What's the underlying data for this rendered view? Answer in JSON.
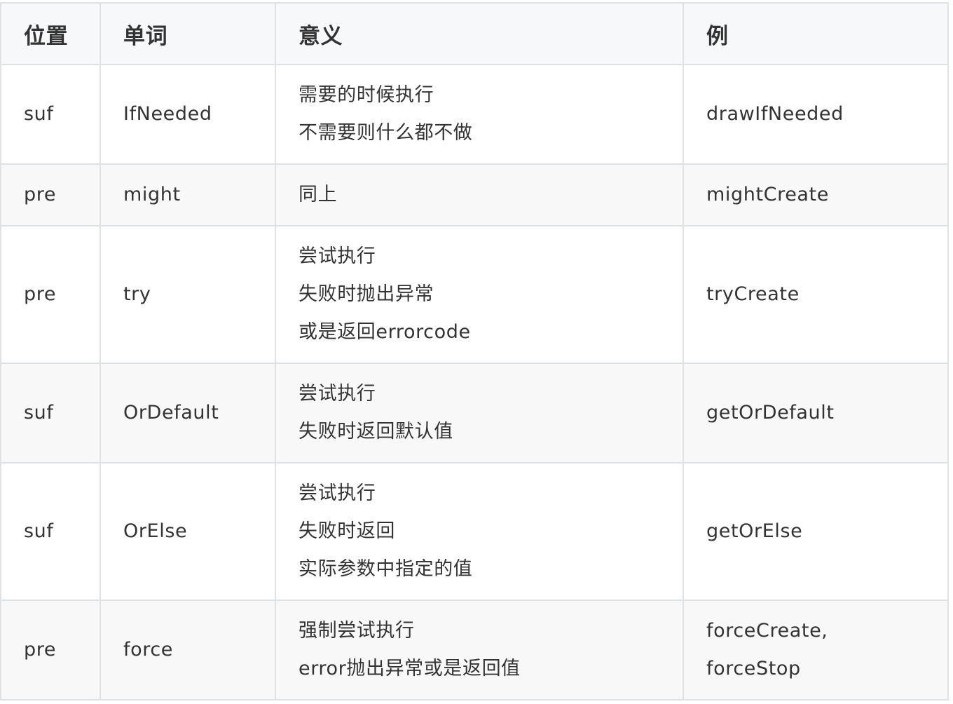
{
  "table": {
    "headers": [
      "位置",
      "单词",
      "意义",
      "例"
    ],
    "rows": [
      {
        "position": "suf",
        "word": "IfNeeded",
        "meaning": [
          "需要的时候执行",
          "不需要则什么都不做"
        ],
        "example": [
          "drawIfNeeded"
        ]
      },
      {
        "position": "pre",
        "word": "might",
        "meaning": [
          "同上"
        ],
        "example": [
          "mightCreate"
        ]
      },
      {
        "position": "pre",
        "word": "try",
        "meaning": [
          "尝试执行",
          "失败时抛出异常",
          "或是返回errorcode"
        ],
        "example": [
          "tryCreate"
        ]
      },
      {
        "position": "suf",
        "word": "OrDefault",
        "meaning": [
          "尝试执行",
          "失败时返回默认值"
        ],
        "example": [
          "getOrDefault"
        ]
      },
      {
        "position": "suf",
        "word": "OrElse",
        "meaning": [
          "尝试执行",
          "失败时返回",
          "实际参数中指定的值"
        ],
        "example": [
          "getOrElse"
        ]
      },
      {
        "position": "pre",
        "word": "force",
        "meaning": [
          "强制尝试执行",
          "error抛出异常或是返回值"
        ],
        "example": [
          "forceCreate,",
          "forceStop"
        ]
      }
    ]
  }
}
